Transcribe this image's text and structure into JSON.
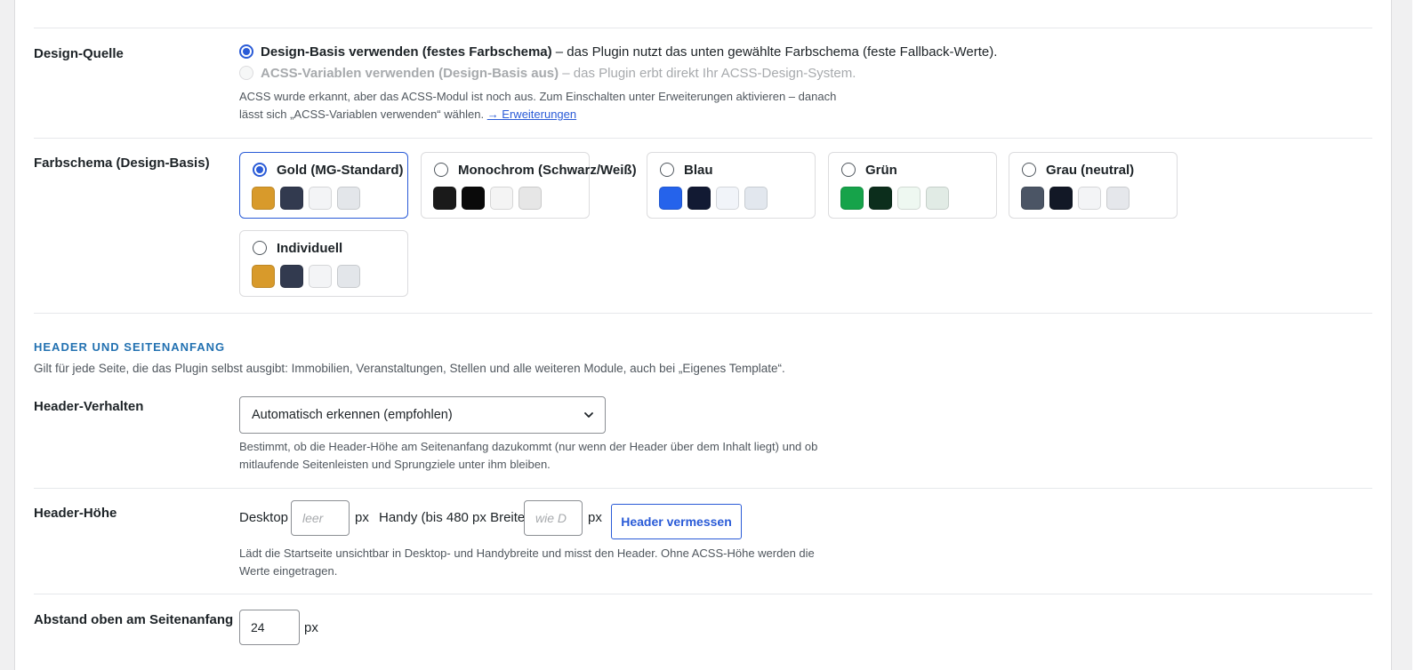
{
  "design_source": {
    "label": "Design-Quelle",
    "option1_bold": "Design-Basis verwenden (festes Farbschema)",
    "option1_rest": " – das Plugin nutzt das unten gewählte Farbschema (feste Fallback-Werte).",
    "option2_bold": "ACSS-Variablen verwenden (Design-Basis aus)",
    "option2_rest": " – das Plugin erbt direkt Ihr ACSS-Design-System.",
    "help_line1": "ACSS wurde erkannt, aber das ACSS-Modul ist noch aus. Zum Einschalten unter Erweiterungen aktivieren – danach",
    "help_line2": "lässt sich „ACSS-Variablen verwenden“ wählen.",
    "help_link": "→ Erweiterungen"
  },
  "color_scheme": {
    "label": "Farbschema (Design-Basis)",
    "cards": [
      {
        "label": "Gold (MG-Standard)",
        "selected": true,
        "swatches": [
          "#d89a2b",
          "#323a4f",
          "#f3f4f6",
          "#e3e6ea"
        ]
      },
      {
        "label": "Monochrom (Schwarz/Weiß)",
        "selected": false,
        "swatches": [
          "#1a1a1a",
          "#0a0a0a",
          "#f4f4f4",
          "#e6e6e6"
        ]
      },
      {
        "label": "Blau",
        "selected": false,
        "swatches": [
          "#2563eb",
          "#121a33",
          "#f1f4f9",
          "#e2e7ee"
        ]
      },
      {
        "label": "Grün",
        "selected": false,
        "swatches": [
          "#16a34a",
          "#0c2e1c",
          "#eef8f1",
          "#e1ebe5"
        ]
      },
      {
        "label": "Grau (neutral)",
        "selected": false,
        "swatches": [
          "#4b5565",
          "#121826",
          "#f3f4f6",
          "#e5e7eb"
        ]
      },
      {
        "label": "Individuell",
        "selected": false,
        "swatches": [
          "#d89a2b",
          "#323a4f",
          "#f3f4f6",
          "#e3e6ea"
        ]
      }
    ]
  },
  "header_section": {
    "title": "HEADER UND SEITENANFANG",
    "description": "Gilt für jede Seite, die das Plugin selbst ausgibt: Immobilien, Veranstaltungen, Stellen und alle weiteren Module, auch bei „Eigenes Template“."
  },
  "header_behavior": {
    "label": "Header-Verhalten",
    "selected": "Automatisch erkennen (empfohlen)",
    "help_line1": "Bestimmt, ob die Header-Höhe am Seitenanfang dazukommt (nur wenn der Header über dem Inhalt liegt) und ob",
    "help_line2": "mitlaufende Seitenleisten und Sprungziele unter ihm bleiben."
  },
  "header_height": {
    "label": "Header-Höhe",
    "desktop_label": "Desktop",
    "desktop_placeholder": "leer",
    "unit1": "px",
    "mobile_label": "Handy (bis 480 px Breite)",
    "mobile_placeholder": "wie D",
    "unit2": "px",
    "button": "Header vermessen",
    "help_line1": "Lädt die Startseite unsichtbar in Desktop- und Handybreite und misst den Header. Ohne ACSS-Höhe werden die",
    "help_line2": "Werte eingetragen."
  },
  "top_spacing": {
    "label": "Abstand oben am Seitenanfang",
    "value": "24",
    "unit": "px"
  }
}
